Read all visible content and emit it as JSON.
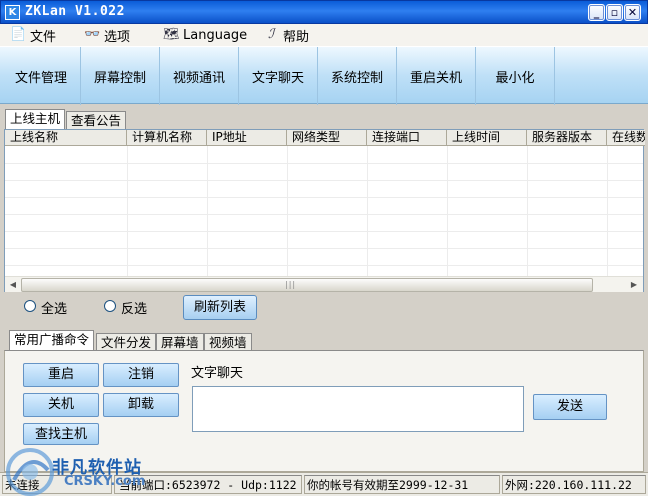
{
  "window": {
    "app_icon": "K",
    "title": "ZKLan V1.022",
    "buttons": {
      "minimize": "_",
      "restore": "▫",
      "close": "✕"
    }
  },
  "menu": {
    "items": [
      {
        "label": "文件",
        "icon": "file-icon"
      },
      {
        "label": "选项",
        "icon": "glasses-icon"
      },
      {
        "label": "Language",
        "icon": "language-icon"
      },
      {
        "label": "帮助",
        "icon": "help-icon"
      }
    ]
  },
  "toolbar": {
    "buttons": [
      "文件管理",
      "屏幕控制",
      "视频通讯",
      "文字聊天",
      "系统控制",
      "重启关机",
      "最小化"
    ]
  },
  "top_tabs": [
    "上线主机",
    "查看公告"
  ],
  "host_list": {
    "columns": [
      "上线名称",
      "计算机名称",
      "IP地址",
      "网络类型",
      "连接端口",
      "上线时间",
      "服务器版本",
      "在线数"
    ],
    "rows": []
  },
  "selection": {
    "select_all": "全选",
    "invert": "反选",
    "refresh": "刷新列表"
  },
  "lower_tabs": [
    "常用广播命令",
    "文件分发",
    "屏幕墙",
    "视频墙"
  ],
  "commands": {
    "restart": "重启",
    "logoff": "注销",
    "shutdown": "关机",
    "uninstall": "卸载",
    "find_host": "查找主机"
  },
  "chat": {
    "label": "文字聊天",
    "send": "发送",
    "value": ""
  },
  "status": {
    "connection": "未连接",
    "ports": "当前端口:6523972 - Udp:1122",
    "expiry": "你的帐号有效期至2999-12-31",
    "external_ip": "外网:220.160.111.22"
  },
  "watermark": {
    "text": "非凡软件站",
    "sub": "CRSKY.com"
  },
  "colors": {
    "titlebar": "#0a5cd8",
    "toolbar": "#bfe0f7",
    "button_blue": "#a5cff2"
  }
}
